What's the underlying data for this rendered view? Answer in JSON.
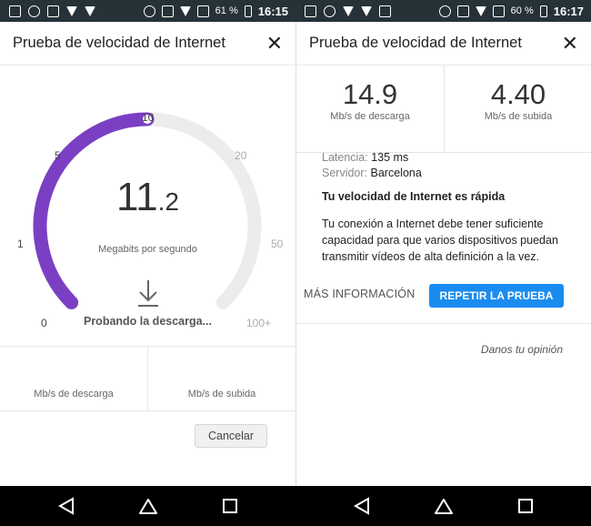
{
  "status_left": {
    "battery": "61 %",
    "time": "16:15"
  },
  "status_right": {
    "battery": "60 %",
    "time": "16:17"
  },
  "left": {
    "title": "Prueba de velocidad de Internet",
    "gauge": {
      "ticks": [
        "0",
        "1",
        "5",
        "10",
        "20",
        "50",
        "100+"
      ],
      "value_int": "11",
      "value_dec": ".2",
      "unit": "Megabits por segundo",
      "progress_fraction": 0.5,
      "status": "Probando la descarga..."
    },
    "download_label": "Mb/s de descarga",
    "upload_label": "Mb/s de subida",
    "cancel_label": "Cancelar"
  },
  "right": {
    "title": "Prueba de velocidad de Internet",
    "download_value": "14.9",
    "download_label": "Mb/s de descarga",
    "upload_value": "4.40",
    "upload_label": "Mb/s de subida",
    "latency_key": "Latencia:",
    "latency_value": "135 ms",
    "server_key": "Servidor:",
    "server_value": "Barcelona",
    "verdict": "Tu velocidad de Internet es rápida",
    "description": "Tu conexión a Internet debe tener suficiente capacidad para que varios dispositivos puedan transmitir vídeos de alta definición a la vez.",
    "more_label": "MÁS INFORMACIÓN",
    "repeat_label": "REPETIR LA PRUEBA",
    "feedback_label": "Danos tu opinión"
  },
  "colors": {
    "accent": "#7b3fc4",
    "button_blue": "#1a8cf0",
    "track": "#ececec",
    "status_bar": "#263238"
  }
}
